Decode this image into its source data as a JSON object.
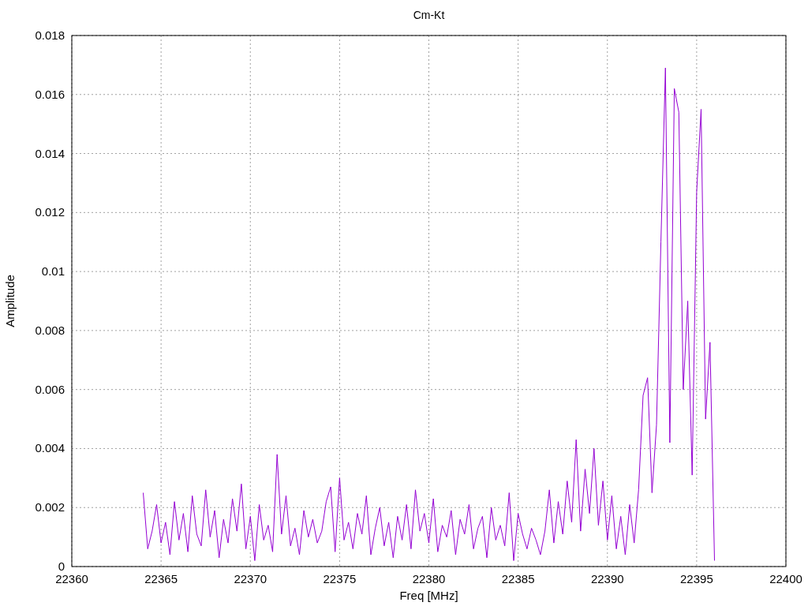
{
  "chart_data": {
    "type": "line",
    "grid": true,
    "title": "Cm-Kt",
    "xlabel": "Freq [MHz]",
    "ylabel": "Amplitude",
    "xlim": [
      22360,
      22400
    ],
    "ylim": [
      0,
      0.018
    ],
    "xticks": [
      22360,
      22365,
      22370,
      22375,
      22380,
      22385,
      22390,
      22395,
      22400
    ],
    "yticks": [
      {
        "value": 0,
        "label": "0"
      },
      {
        "value": 0.002,
        "label": "0.002"
      },
      {
        "value": 0.004,
        "label": "0.004"
      },
      {
        "value": 0.006,
        "label": "0.006"
      },
      {
        "value": 0.008,
        "label": "0.008"
      },
      {
        "value": 0.01,
        "label": "0.01"
      },
      {
        "value": 0.012,
        "label": "0.012"
      },
      {
        "value": 0.014,
        "label": "0.014"
      },
      {
        "value": 0.016,
        "label": "0.016"
      },
      {
        "value": 0.018,
        "label": "0.018"
      }
    ],
    "x": [
      22364,
      22364.25,
      22364.5,
      22364.75,
      22365,
      22365.25,
      22365.5,
      22365.75,
      22366,
      22366.25,
      22366.5,
      22366.75,
      22367,
      22367.25,
      22367.5,
      22367.75,
      22368,
      22368.25,
      22368.5,
      22368.75,
      22369,
      22369.25,
      22369.5,
      22369.75,
      22370,
      22370.25,
      22370.5,
      22370.75,
      22371,
      22371.25,
      22371.5,
      22371.75,
      22372,
      22372.25,
      22372.5,
      22372.75,
      22373,
      22373.25,
      22373.5,
      22373.75,
      22374,
      22374.25,
      22374.5,
      22374.75,
      22375,
      22375.25,
      22375.5,
      22375.75,
      22376,
      22376.25,
      22376.5,
      22376.75,
      22377,
      22377.25,
      22377.5,
      22377.75,
      22378,
      22378.25,
      22378.5,
      22378.75,
      22379,
      22379.25,
      22379.5,
      22379.75,
      22380,
      22380.25,
      22380.5,
      22380.75,
      22381,
      22381.25,
      22381.5,
      22381.75,
      22382,
      22382.25,
      22382.5,
      22382.75,
      22383,
      22383.25,
      22383.5,
      22383.75,
      22384,
      22384.25,
      22384.5,
      22384.75,
      22385,
      22385.25,
      22385.5,
      22385.75,
      22386,
      22386.25,
      22386.5,
      22386.75,
      22387,
      22387.25,
      22387.5,
      22387.75,
      22388,
      22388.25,
      22388.5,
      22388.75,
      22389,
      22389.25,
      22389.5,
      22389.75,
      22390,
      22390.25,
      22390.5,
      22390.75,
      22391,
      22391.25,
      22391.5,
      22391.75,
      22392,
      22392.25,
      22392.5,
      22392.75,
      22393,
      22393.25,
      22393.5,
      22393.75,
      22394,
      22394.25,
      22394.5,
      22394.75,
      22395,
      22395.25,
      22395.5,
      22395.75,
      22396
    ],
    "series": [
      {
        "color": "#9400d3",
        "values": [
          0.0025,
          0.0006,
          0.0012,
          0.0021,
          0.0008,
          0.0015,
          0.0004,
          0.0022,
          0.0009,
          0.0018,
          0.0005,
          0.0024,
          0.0011,
          0.0007,
          0.0026,
          0.001,
          0.0019,
          0.0003,
          0.0016,
          0.0008,
          0.0023,
          0.0012,
          0.0028,
          0.0006,
          0.0017,
          0.0002,
          0.0021,
          0.0009,
          0.0014,
          0.0005,
          0.0038,
          0.0011,
          0.0024,
          0.0007,
          0.0013,
          0.0004,
          0.0019,
          0.001,
          0.0016,
          0.0008,
          0.0012,
          0.0022,
          0.0027,
          0.0005,
          0.003,
          0.0009,
          0.0015,
          0.0006,
          0.0018,
          0.0011,
          0.0024,
          0.0004,
          0.0013,
          0.002,
          0.0007,
          0.0015,
          0.0003,
          0.0017,
          0.0009,
          0.0021,
          0.0006,
          0.0026,
          0.0012,
          0.0018,
          0.0008,
          0.0023,
          0.0005,
          0.0014,
          0.001,
          0.0019,
          0.0004,
          0.0016,
          0.0011,
          0.0021,
          0.0006,
          0.0013,
          0.0017,
          0.0003,
          0.002,
          0.0009,
          0.0014,
          0.0007,
          0.0025,
          0.0002,
          0.0018,
          0.0011,
          0.0006,
          0.0013,
          0.0009,
          0.0004,
          0.0012,
          0.0026,
          0.0008,
          0.0022,
          0.0011,
          0.0029,
          0.0015,
          0.0043,
          0.0012,
          0.0033,
          0.0018,
          0.004,
          0.0014,
          0.0029,
          0.0009,
          0.0024,
          0.0006,
          0.0017,
          0.0004,
          0.0021,
          0.0008,
          0.0026,
          0.0058,
          0.0064,
          0.0025,
          0.0048,
          0.011,
          0.0169,
          0.0042,
          0.0162,
          0.0154,
          0.006,
          0.009,
          0.0031,
          0.0127,
          0.0155,
          0.005,
          0.0076,
          0.0002
        ]
      }
    ]
  }
}
